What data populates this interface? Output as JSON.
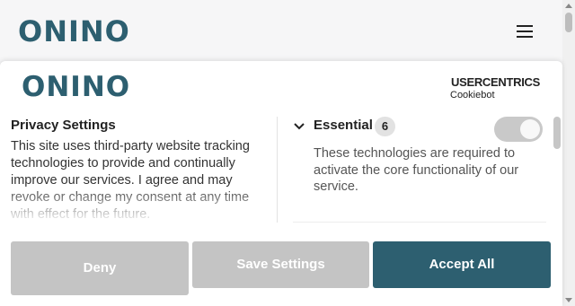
{
  "site": {
    "logo": "ONINO"
  },
  "banner": {
    "logo": "ONINO",
    "vendor": {
      "brand": "USERCENTRICS",
      "product": "Cookiebot"
    },
    "privacy": {
      "title": "Privacy Settings",
      "text": "This site uses third-party website tracking technologies to provide and continually improve our services. I agree and may revoke or change my consent at any time with effect for the future."
    },
    "essential": {
      "title": "Essential",
      "count": "6",
      "enabled": true,
      "description": "These technologies are required to activate the core functionality of our service."
    },
    "buttons": {
      "deny": "Deny",
      "save": "Save Settings",
      "accept": "Accept All"
    }
  },
  "colors": {
    "brand": "#2d5f70",
    "button_disabled": "#c4c4c4"
  },
  "icons": {
    "menu": "hamburger-menu-icon",
    "expand": "chevron-down-icon",
    "vendor": "shield-icon"
  }
}
